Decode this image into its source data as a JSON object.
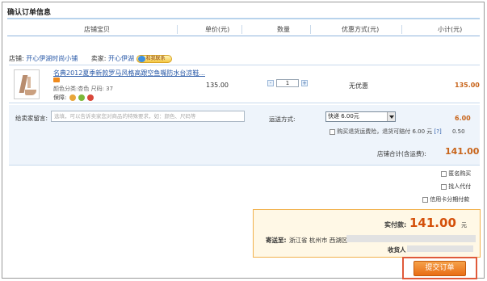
{
  "page": {
    "title": "确认订单信息"
  },
  "columns": [
    "店铺宝贝",
    "单价(元)",
    "数量",
    "优惠方式(元)",
    "小计(元)"
  ],
  "shop": {
    "shop_label": "店铺:",
    "shop_name": "开心伊湖时尚小铺",
    "seller_label": "卖家:",
    "seller_name": "开心伊湖",
    "contact_badge": "和我联系"
  },
  "item": {
    "title": "名典2012夏季新款罗马风格高跟空鱼嘴防水台凉鞋...",
    "attrs": "颜色分类:杏色  尺码: 37",
    "guarantee_label": "保障:",
    "unit_price": "135.00",
    "quantity": "1",
    "minus": "-",
    "plus": "+",
    "discount": "无优惠",
    "subtotal": "135.00"
  },
  "shipping": {
    "message_label": "给卖家留言:",
    "message_placeholder": "选填，可以告诉卖家您对商品的特殊要求，如：颜色、尺码等",
    "method_label": "运送方式:",
    "method_value": "快递 6.00元",
    "price": "6.00",
    "insurance_text": "购买退货运费险，退货可赔付 6.00 元",
    "insurance_help": "[?]",
    "insurance_price": "0.50",
    "shop_total_label": "店铺合计(含运费):",
    "shop_total": "141.00"
  },
  "options": {
    "anonymous": "匿名购买",
    "proxy_pay": "找人代付",
    "installment": "信用卡分期付款"
  },
  "summary": {
    "pay_label": "实付款:",
    "pay_amount": "141.00",
    "pay_unit": "元",
    "address_label": "寄送至:",
    "address_value": "浙江省 杭州市 西湖区",
    "receiver_label": "收货人"
  },
  "submit": {
    "label": "提交订单"
  },
  "colors": {
    "accent_orange": "#e96d14",
    "price_orange": "#c8641a",
    "link_blue": "#2a5aa8",
    "summary_bg": "#fff8e6"
  }
}
